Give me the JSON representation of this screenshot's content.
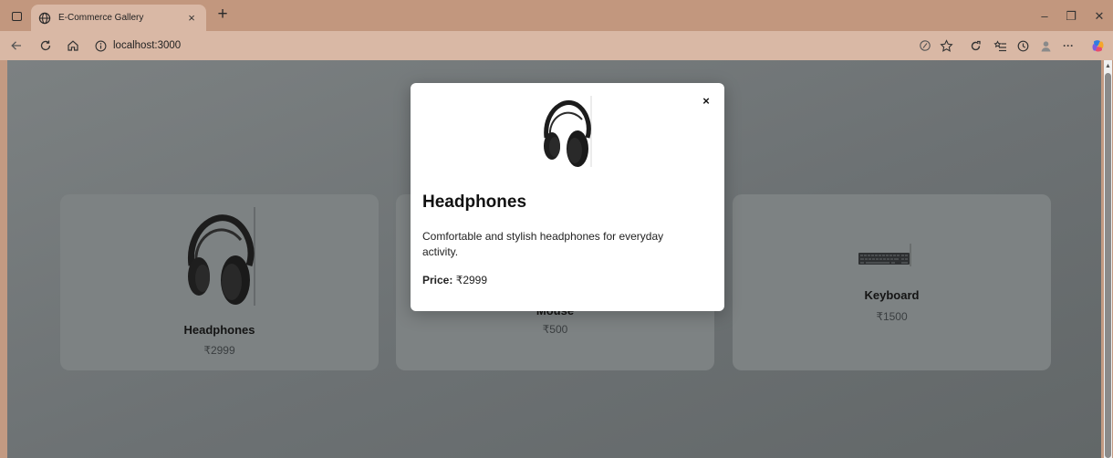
{
  "browser": {
    "tab_title": "E-Commerce Gallery",
    "tab_close": "×",
    "new_tab": "+",
    "url": "localhost:3000",
    "window_controls": {
      "minimize": "–",
      "restore": "❐",
      "close": "✕"
    },
    "toolbar_icons": [
      "read-aloud-icon",
      "favorite-star-icon",
      "extensions-icon",
      "collections-icon",
      "history-icon",
      "profile-icon",
      "more-icon",
      "copilot-icon"
    ],
    "more_label": "···"
  },
  "products": [
    {
      "name": "Headphones",
      "price": "₹2999",
      "image": "headphones"
    },
    {
      "name": "Mouse",
      "price": "₹500",
      "image": "mouse"
    },
    {
      "name": "Keyboard",
      "price": "₹1500",
      "image": "keyboard"
    }
  ],
  "modal": {
    "close_label": "×",
    "title": "Headphones",
    "description": "Comfortable and stylish headphones for everyday activity.",
    "price_label": "Price:",
    "price_value": "₹2999"
  },
  "colors": {
    "chrome": "#c2977e",
    "toolbar": "#d9b8a5",
    "overlay_page": "#6c7173",
    "card": "#7d8283",
    "modal_bg": "#ffffff"
  }
}
